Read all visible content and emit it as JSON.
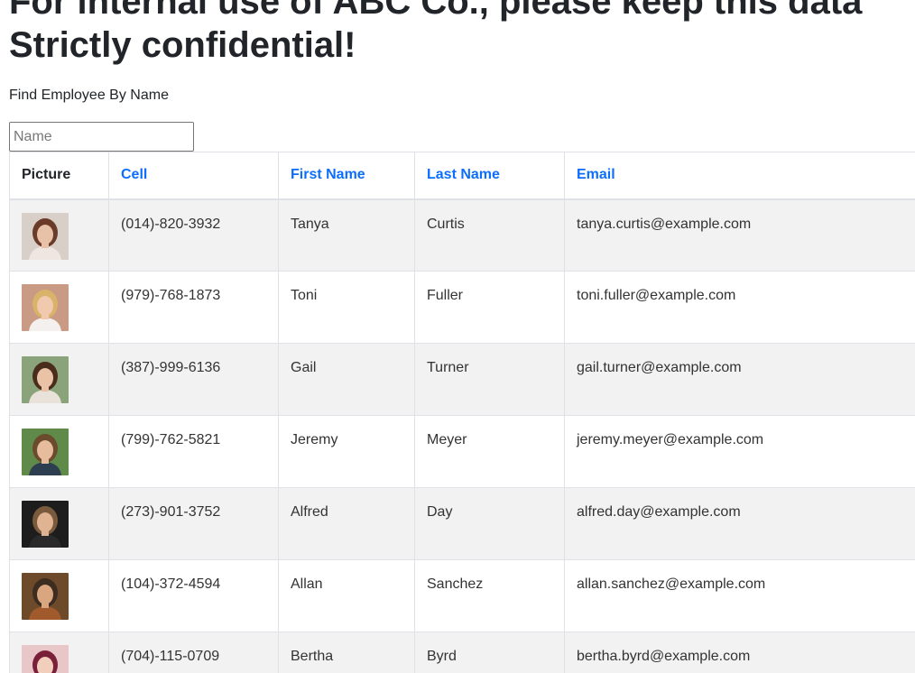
{
  "header": {
    "title_line1": "For internal use of ABC Co., please keep this data",
    "title_line2": "Strictly confidential!",
    "find_label": "Find Employee By Name"
  },
  "search": {
    "placeholder": "Name",
    "value": ""
  },
  "table": {
    "columns": {
      "picture": "Picture",
      "cell": "Cell",
      "first_name": "First Name",
      "last_name": "Last Name",
      "email": "Email"
    },
    "rows": [
      {
        "cell": "(014)-820-3932",
        "first": "Tanya",
        "last": "Curtis",
        "email": "tanya.curtis@example.com",
        "avatar": {
          "bg": "#d9cfc9",
          "hair": "#6b3b2a",
          "skin": "#e8c2a8",
          "shirt": "#efe6e1"
        }
      },
      {
        "cell": "(979)-768-1873",
        "first": "Toni",
        "last": "Fuller",
        "email": "toni.fuller@example.com",
        "avatar": {
          "bg": "#c99a84",
          "hair": "#d9b36a",
          "skin": "#f0c9ae",
          "shirt": "#f4f0ee"
        }
      },
      {
        "cell": "(387)-999-6136",
        "first": "Gail",
        "last": "Turner",
        "email": "gail.turner@example.com",
        "avatar": {
          "bg": "#8aa37a",
          "hair": "#4a2c1d",
          "skin": "#eac3a6",
          "shirt": "#e9e2da"
        }
      },
      {
        "cell": "(799)-762-5821",
        "first": "Jeremy",
        "last": "Meyer",
        "email": "jeremy.meyer@example.com",
        "avatar": {
          "bg": "#5f8a4a",
          "hair": "#6b4a2e",
          "skin": "#e6bc9c",
          "shirt": "#2c3e50"
        }
      },
      {
        "cell": "(273)-901-3752",
        "first": "Alfred",
        "last": "Day",
        "email": "alfred.day@example.com",
        "avatar": {
          "bg": "#1d1d1d",
          "hair": "#7a5a3c",
          "skin": "#e0b493",
          "shirt": "#2a2a2a"
        }
      },
      {
        "cell": "(104)-372-4594",
        "first": "Allan",
        "last": "Sanchez",
        "email": "allan.sanchez@example.com",
        "avatar": {
          "bg": "#6d4a2a",
          "hair": "#3d2c20",
          "skin": "#d9a680",
          "shirt": "#a05a2c"
        }
      },
      {
        "cell": "(704)-115-0709",
        "first": "Bertha",
        "last": "Byrd",
        "email": "bertha.byrd@example.com",
        "avatar": {
          "bg": "#e9c7c9",
          "hair": "#7a1f3a",
          "skin": "#f2cfbd",
          "shirt": "#f6e6e8"
        }
      }
    ]
  }
}
